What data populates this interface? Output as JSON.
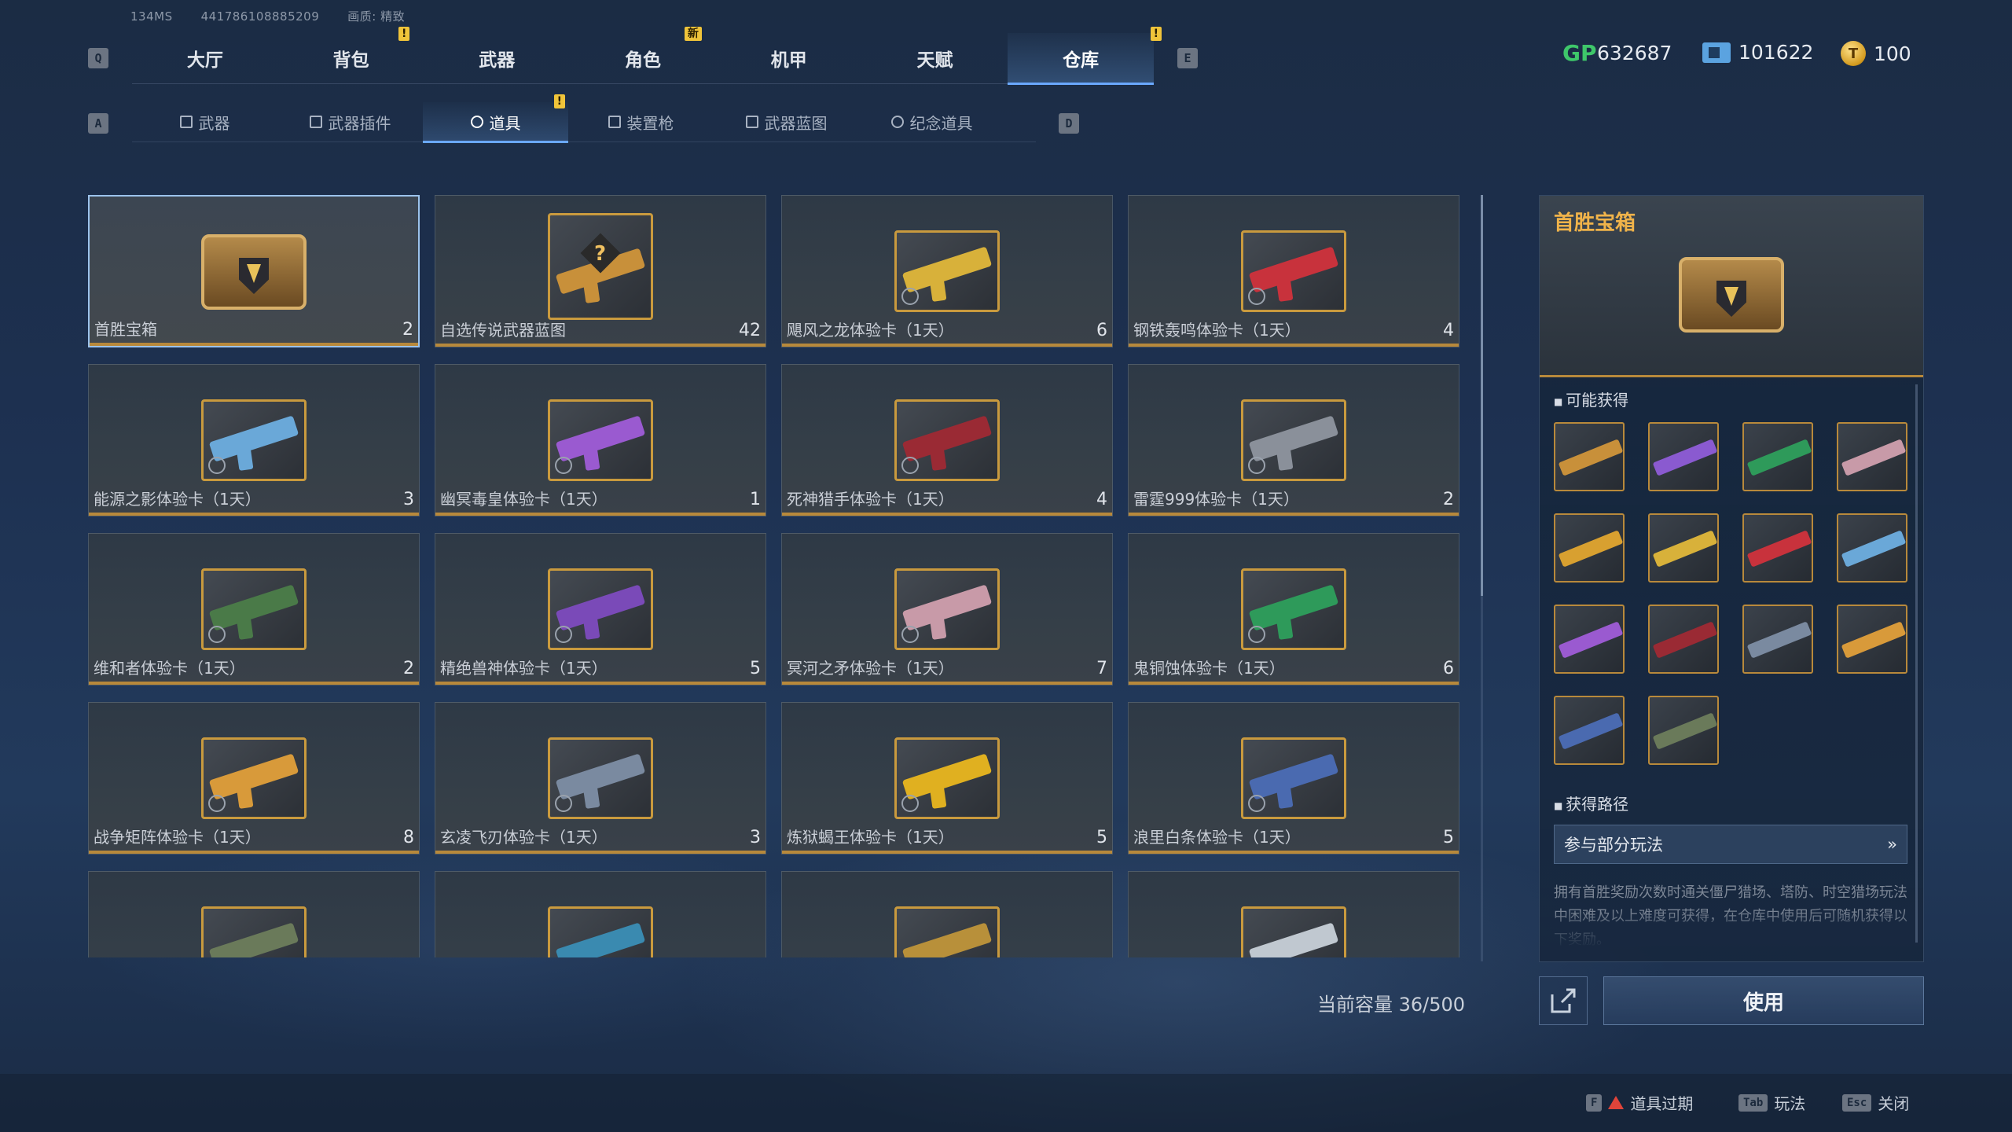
{
  "top_info": {
    "ping": "134MS",
    "uid": "441786108885209",
    "quality": "画质: 精致"
  },
  "keys": {
    "q": "Q",
    "e": "E",
    "a": "A",
    "d": "D"
  },
  "main_tabs": [
    {
      "label": "大厅",
      "badge": ""
    },
    {
      "label": "背包",
      "badge": "!"
    },
    {
      "label": "武器",
      "badge": ""
    },
    {
      "label": "角色",
      "badge": "新"
    },
    {
      "label": "机甲",
      "badge": ""
    },
    {
      "label": "天赋",
      "badge": ""
    },
    {
      "label": "仓库",
      "badge": "!",
      "active": true
    }
  ],
  "sub_tabs": [
    {
      "label": "武器",
      "icon": "gun-icon"
    },
    {
      "label": "武器插件",
      "icon": "plugin-icon"
    },
    {
      "label": "道具",
      "icon": "item-icon",
      "badge": "!",
      "active": true
    },
    {
      "label": "装置枪",
      "icon": "device-icon"
    },
    {
      "label": "武器蓝图",
      "icon": "blueprint-icon"
    },
    {
      "label": "纪念道具",
      "icon": "souvenir-icon"
    }
  ],
  "currency": {
    "gp": "632687",
    "ticket": "101622",
    "coin": "100",
    "gp_label": "GP",
    "coin_symbol": "T"
  },
  "items": [
    {
      "name": "首胜宝箱",
      "count": "2",
      "type": "chest",
      "selected": true
    },
    {
      "name": "自选传说武器蓝图",
      "count": "42",
      "type": "blueprint"
    },
    {
      "name": "飓风之龙体验卡（1天）",
      "count": "6",
      "color": "#d8b13a"
    },
    {
      "name": "钢铁轰鸣体验卡（1天）",
      "count": "4",
      "color": "#c8323c"
    },
    {
      "name": "能源之影体验卡（1天）",
      "count": "3",
      "color": "#6aa8d8"
    },
    {
      "name": "幽冥毒皇体验卡（1天）",
      "count": "1",
      "color": "#9a5ad0"
    },
    {
      "name": "死神猎手体验卡（1天）",
      "count": "4",
      "color": "#9a2a34"
    },
    {
      "name": "雷霆999体验卡（1天）",
      "count": "2",
      "color": "#8a909a"
    },
    {
      "name": "维和者体验卡（1天）",
      "count": "2",
      "color": "#4a7a48"
    },
    {
      "name": "精绝兽神体验卡（1天）",
      "count": "5",
      "color": "#7a4ab8"
    },
    {
      "name": "冥河之矛体验卡（1天）",
      "count": "7",
      "color": "#c89aa8"
    },
    {
      "name": "鬼铜蚀体验卡（1天）",
      "count": "6",
      "color": "#2e9a5a"
    },
    {
      "name": "战争矩阵体验卡（1天）",
      "count": "8",
      "color": "#d89a3a"
    },
    {
      "name": "玄凌飞刃体验卡（1天）",
      "count": "3",
      "color": "#7a8aa0"
    },
    {
      "name": "炼狱蝎王体验卡（1天）",
      "count": "5",
      "color": "#e0b020"
    },
    {
      "name": "浪里白条体验卡（1天）",
      "count": "5",
      "color": "#4a6ab0"
    },
    {
      "name": "",
      "count": "",
      "color": "#6a7a5a"
    },
    {
      "name": "",
      "count": "",
      "color": "#3a8ab0"
    },
    {
      "name": "",
      "count": "",
      "color": "#b8903a"
    },
    {
      "name": "",
      "count": "",
      "color": "#c0c8d0"
    }
  ],
  "capacity": "当前容量 36/500",
  "detail": {
    "title": "首胜宝箱",
    "rewards_label": "可能获得",
    "rewards": [
      "#c8903a",
      "#8a5ad0",
      "#2e9a5a",
      "#c89aa8",
      "#d8a030",
      "#d8b13a",
      "#c8323c",
      "#6aa8d8",
      "#9a5ad0",
      "#9a2a34",
      "#7a8aa0",
      "#d89a3a",
      "#4a6ab0",
      "#6a7a5a"
    ],
    "path_label": "获得路径",
    "path_button": "参与部分玩法",
    "description": "拥有首胜奖励次数时通关僵尸猎场、塔防、时空猎场玩法中困难及以上难度可获得，在仓库中使用后可随机获得以下奖励。"
  },
  "use_button": "使用",
  "footer": [
    {
      "key": "F",
      "label": "道具过期"
    },
    {
      "key": "Tab",
      "label": "玩法"
    },
    {
      "key": "Esc",
      "label": "关闭"
    }
  ]
}
